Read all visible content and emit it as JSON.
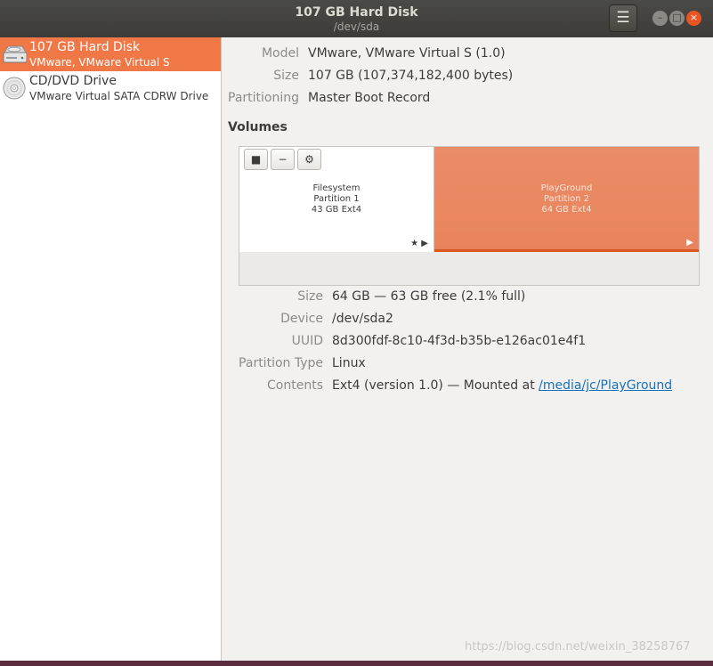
{
  "window": {
    "title": "107 GB Hard Disk",
    "subtitle": "/dev/sda",
    "menu_icon": "hamburger-icon",
    "controls": [
      "minimize-icon",
      "maximize-icon",
      "close-icon"
    ]
  },
  "sidebar": {
    "items": [
      {
        "name": "107 GB Hard Disk",
        "description": "VMware, VMware Virtual S",
        "icon": "hard-disk-icon",
        "selected": true
      },
      {
        "name": "CD/DVD Drive",
        "description": "VMware Virtual SATA CDRW Drive",
        "icon": "optical-disc-icon",
        "selected": false
      }
    ]
  },
  "disk": {
    "model_label": "Model",
    "model_value": "VMware, VMware Virtual S (1.0)",
    "size_label": "Size",
    "size_value": "107 GB (107,374,182,400 bytes)",
    "partitioning_label": "Partitioning",
    "partitioning_value": "Master Boot Record"
  },
  "volumes": {
    "heading": "Volumes",
    "partitions": [
      {
        "line1": "Filesystem",
        "line2": "Partition 1",
        "line3": "43 GB Ext4",
        "marks": "★ ▶"
      },
      {
        "line1": "PlayGround",
        "line2": "Partition 2",
        "line3": "64 GB Ext4",
        "marks": "▶"
      }
    ],
    "toolbar": {
      "stop_symbol": "■",
      "remove_symbol": "−",
      "settings_symbol": "⚙"
    }
  },
  "details": {
    "size_label": "Size",
    "size_value": "64 GB — 63 GB free (2.1% full)",
    "device_label": "Device",
    "device_value": "/dev/sda2",
    "uuid_label": "UUID",
    "uuid_value": "8d300fdf-8c10-4f3d-b35b-e126ac01e4f1",
    "partition_type_label": "Partition Type",
    "partition_type_value": "Linux",
    "contents_label": "Contents",
    "contents_prefix": "Ext4 (version 1.0) — Mounted at ",
    "contents_link": "/media/jc/PlayGround"
  },
  "watermark": "https://blog.csdn.net/weixin_38258767",
  "colors": {
    "accent": "#f07746",
    "selected_partition": "#e8845d",
    "link": "#1a72b9",
    "titlebar": "#3c3b37"
  }
}
